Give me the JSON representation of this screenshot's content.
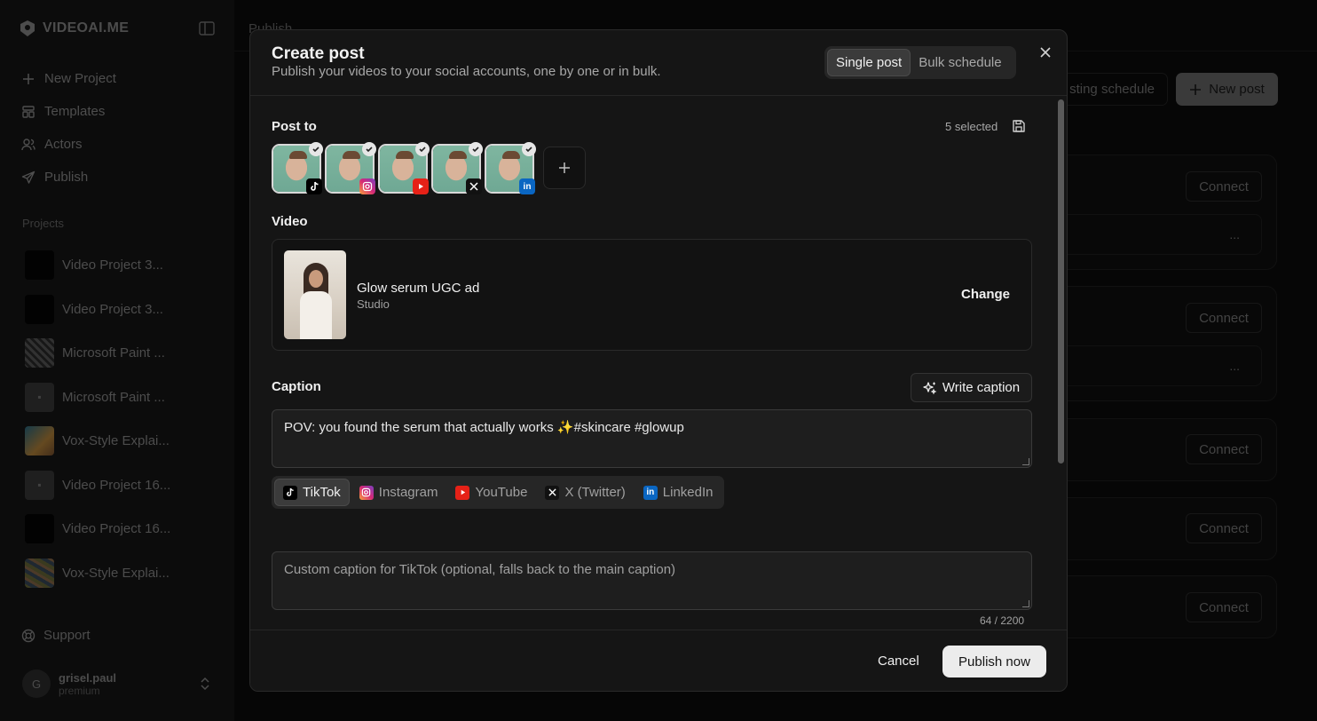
{
  "sidebar": {
    "brand": "VIDEOAI.ME",
    "nav": [
      {
        "label": "New Project",
        "icon": "plus-icon"
      },
      {
        "label": "Templates",
        "icon": "templates-icon"
      },
      {
        "label": "Actors",
        "icon": "users-icon"
      },
      {
        "label": "Publish",
        "icon": "send-icon"
      }
    ],
    "projects_label": "Projects",
    "projects": [
      {
        "name": "Video Project 3...",
        "thumb": "black"
      },
      {
        "name": "Video Project 3...",
        "thumb": "black"
      },
      {
        "name": "Microsoft Paint ...",
        "thumb": "noise"
      },
      {
        "name": "Microsoft Paint ...",
        "thumb": "image-placeholder"
      },
      {
        "name": "Vox-Style Explai...",
        "thumb": "color"
      },
      {
        "name": "Video Project 16...",
        "thumb": "image-placeholder"
      },
      {
        "name": "Video Project 16...",
        "thumb": "black"
      },
      {
        "name": "Vox-Style Explai...",
        "thumb": "color2"
      }
    ],
    "support": "Support",
    "user": {
      "initial": "G",
      "name": "grisel.paul",
      "plan": "premium"
    }
  },
  "page": {
    "title": "Publish",
    "schedule_button": "sting schedule",
    "new_post_button": "New post",
    "connect_label": "Connect",
    "partial_text": ")",
    "more_label": "..."
  },
  "modal": {
    "title": "Create post",
    "subtitle": "Publish your videos to your social accounts, one by one or in bulk.",
    "mode_options": [
      "Single post",
      "Bulk schedule"
    ],
    "mode_selected": "Single post",
    "post_to_label": "Post to",
    "selected_count": "5 selected",
    "accounts": [
      {
        "platform": "TikTok",
        "badge_color": "#000000",
        "badge_icon": "tiktok-icon"
      },
      {
        "platform": "Instagram",
        "badge_color": "#d62976",
        "badge_icon": "instagram-icon"
      },
      {
        "platform": "YouTube",
        "badge_color": "#ff0000",
        "badge_icon": "youtube-icon"
      },
      {
        "platform": "X (Twitter)",
        "badge_color": "#000000",
        "badge_icon": "x-icon"
      },
      {
        "platform": "LinkedIn",
        "badge_color": "#0a66c2",
        "badge_icon": "linkedin-icon"
      }
    ],
    "video_label": "Video",
    "video": {
      "name": "Glow serum UGC ad",
      "source": "Studio",
      "change_label": "Change"
    },
    "caption_label": "Caption",
    "write_caption_label": "Write caption",
    "caption_value": "POV: you found the serum that actually works ✨#skincare #glowup",
    "platform_tabs": [
      {
        "label": "TikTok",
        "icon": "tiktok-icon",
        "color": "#000000"
      },
      {
        "label": "Instagram",
        "icon": "instagram-icon",
        "color": "#d62976"
      },
      {
        "label": "YouTube",
        "icon": "youtube-icon",
        "color": "#ff0000"
      },
      {
        "label": "X (Twitter)",
        "icon": "x-icon",
        "color": "#000000"
      },
      {
        "label": "LinkedIn",
        "icon": "linkedin-icon",
        "color": "#0a66c2"
      }
    ],
    "platform_tab_selected": "TikTok",
    "custom_caption_placeholder": "Custom caption for TikTok (optional, falls back to the main caption)",
    "char_count": "64 / 2200",
    "cancel_label": "Cancel",
    "publish_label": "Publish now"
  }
}
